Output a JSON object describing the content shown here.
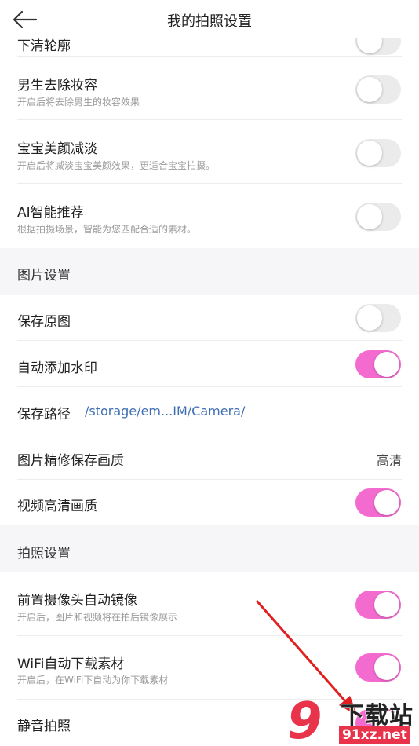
{
  "header": {
    "title": "我的拍照设置"
  },
  "rows": {
    "partial": {
      "label": "下清轮廓"
    },
    "male_makeup": {
      "label": "男生去除妆容",
      "desc": "开启后将去除男生的妆容效果",
      "on": false
    },
    "baby_beauty": {
      "label": "宝宝美颜减淡",
      "desc": "开启后将减淡宝宝美颜效果，更适合宝宝拍摄。",
      "on": false
    },
    "ai_recommend": {
      "label": "AI智能推荐",
      "desc": "根据拍摄场景，智能为您匹配合适的素材。",
      "on": false
    },
    "save_original": {
      "label": "保存原图",
      "on": false
    },
    "watermark": {
      "label": "自动添加水印",
      "on": true
    },
    "save_path": {
      "label": "保存路径",
      "value": "/storage/em...IM/Camera/"
    },
    "retouch_quality": {
      "label": "图片精修保存画质",
      "value": "高清"
    },
    "video_hd": {
      "label": "视频高清画质",
      "on": true
    },
    "front_mirror": {
      "label": "前置摄像头自动镜像",
      "desc": "开启后，图片和视频将在拍后镜像展示",
      "on": true
    },
    "wifi_download": {
      "label": "WiFi自动下载素材",
      "desc": "开启后，在WiFi下自动为你下载素材",
      "on": true
    },
    "silent": {
      "label": "静音拍照",
      "on": true
    }
  },
  "sections": {
    "image": "图片设置",
    "photo": "拍照设置"
  },
  "watermark_overlay": {
    "text": "下载站",
    "url": "91xz.net",
    "logo": "9"
  },
  "colors": {
    "toggle_on": "#f46bd0",
    "toggle_off": "#ebebeb",
    "path": "#3f6fb5",
    "arrow": "#e02020"
  }
}
